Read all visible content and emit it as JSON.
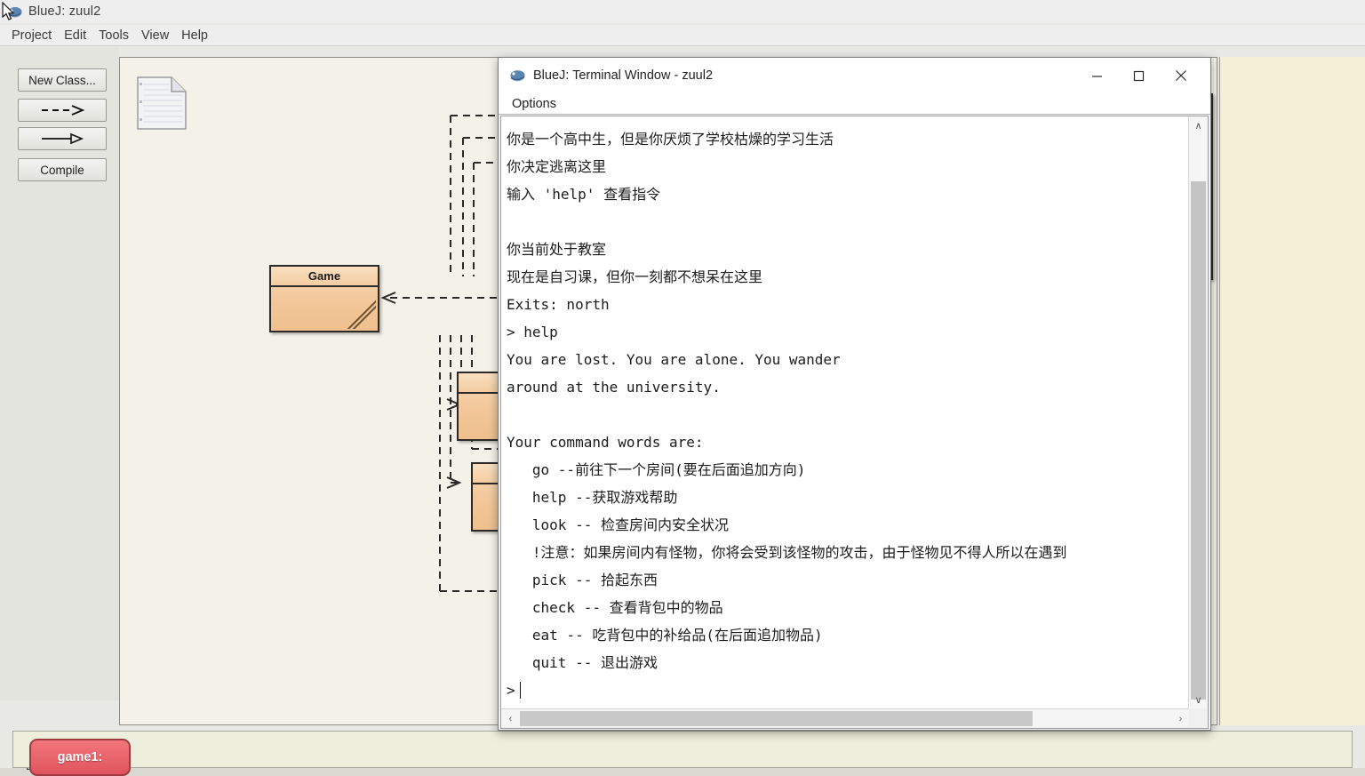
{
  "app": {
    "title": "BlueJ:  zuul2",
    "icon": "bluej-icon",
    "menus": [
      "Project",
      "Edit",
      "Tools",
      "View",
      "Help"
    ]
  },
  "toolbar": {
    "new_class_label": "New Class...",
    "dashed_arrow_label": "--->",
    "solid_arrow_label": "—▷",
    "compile_label": "Compile"
  },
  "diagram": {
    "note_icon": "note-icon",
    "classes": [
      {
        "name": "Game"
      },
      {
        "name": ""
      },
      {
        "name": ""
      },
      {
        "name": ""
      }
    ]
  },
  "object_bench": {
    "objects": [
      {
        "label": "game1:"
      }
    ]
  },
  "terminal": {
    "title": "BlueJ: Terminal Window - zuul2",
    "icon": "bluej-icon",
    "menus": [
      "Options"
    ],
    "window_controls": {
      "minimize": "─",
      "maximize": "☐",
      "close": "✕"
    },
    "lines": [
      "你是一个高中生，但是你厌烦了学校枯燥的学习生活",
      "你决定逃离这里",
      "输入 'help' 查看指令",
      "",
      "你当前处于教室",
      "现在是自习课，但你一刻都不想呆在这里",
      "Exits: north",
      "> help",
      "You are lost. You are alone. You wander",
      "around at the university.",
      "",
      "Your command words are:",
      "   go --前往下一个房间(要在后面追加方向)",
      "   help --获取游戏帮助",
      "   look -- 检查房间内安全状况",
      "   !注意：如果房间内有怪物，你将会受到该怪物的攻击，由于怪物见不得人所以在遇到",
      "   pick -- 拾起东西",
      "   check -- 查看背包中的物品",
      "   eat -- 吃背包中的补给品(在后面追加物品)",
      "   quit -- 退出游戏",
      ">"
    ],
    "prompt": ">",
    "scroll": {
      "up_arrow": "∧",
      "down_arrow": "∨",
      "left_arrow": "‹",
      "right_arrow": "›"
    }
  },
  "colors": {
    "class_fill": "#f2c79a",
    "class_border": "#2b2a28",
    "canvas_bg": "#f4f2e8",
    "bench_object": "#e0545c",
    "terminal_bg": "#ffffff",
    "right_panel": "#f4f0d8"
  }
}
